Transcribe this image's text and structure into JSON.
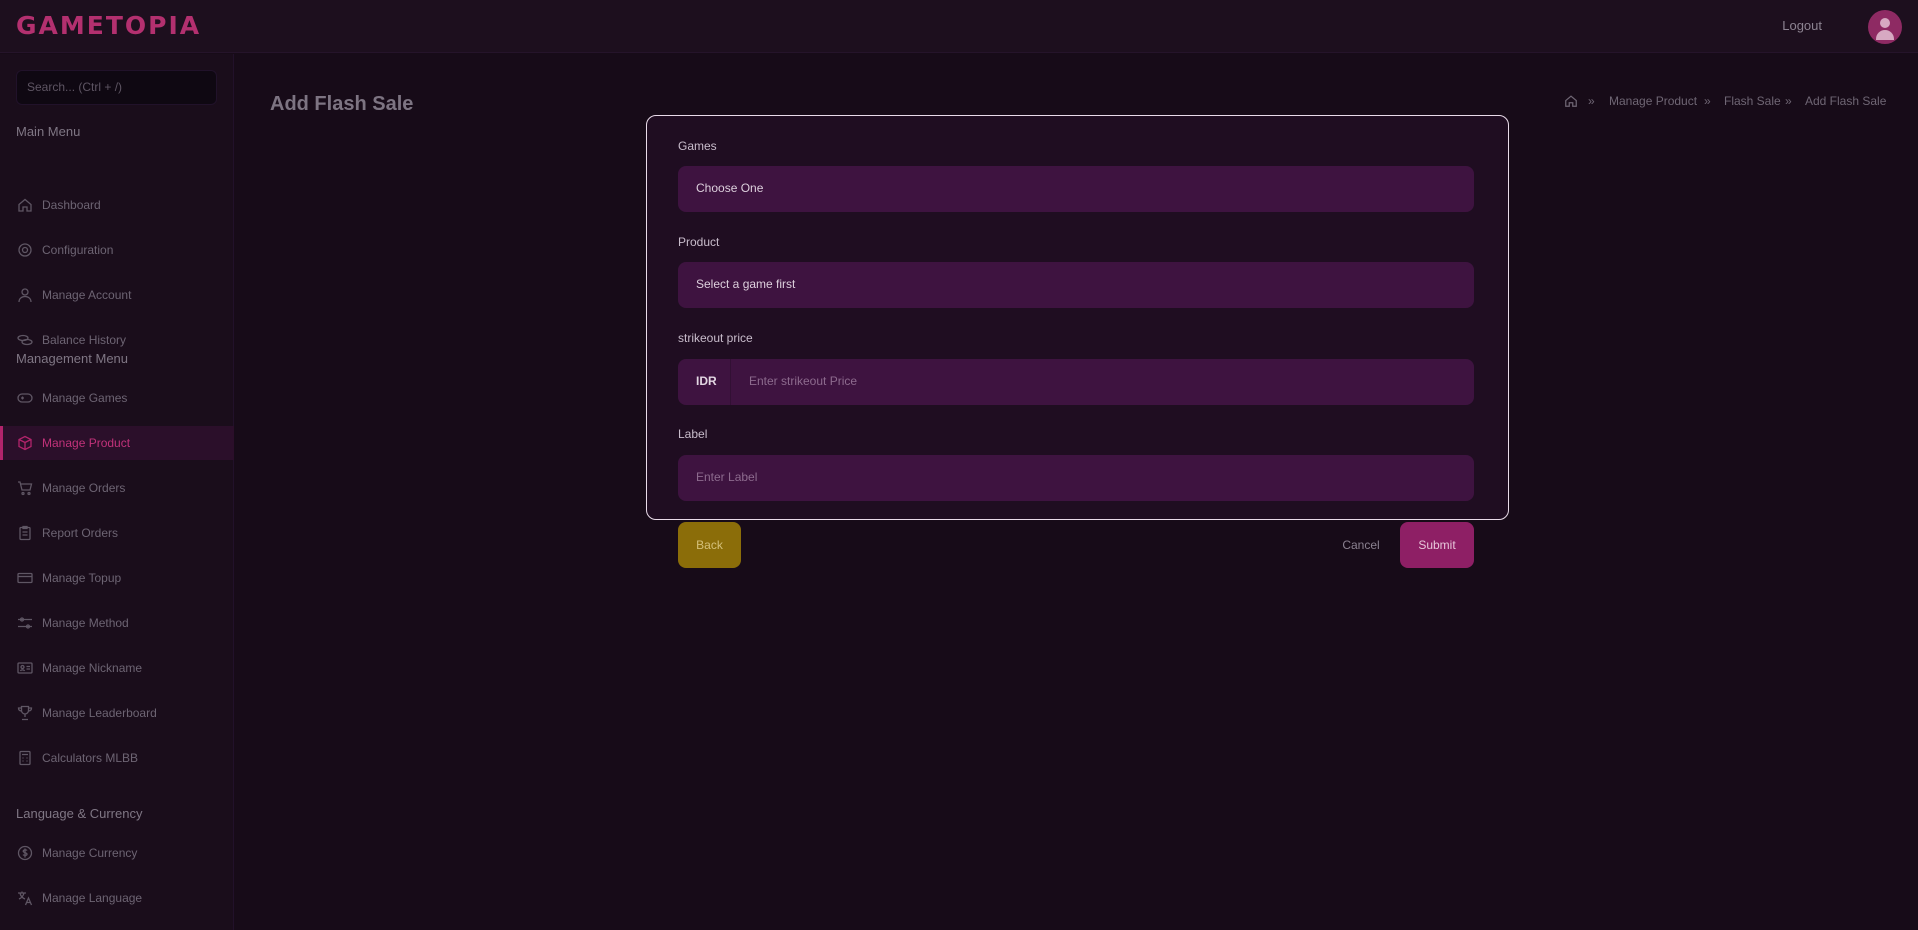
{
  "app": {
    "logo": "GAMETOPIA"
  },
  "header": {
    "logout_label": "Logout"
  },
  "sidebar": {
    "search_placeholder": "Search... (Ctrl + /)",
    "main_menu_title": "Main Menu",
    "main_items": [
      {
        "label": "Dashboard",
        "icon": "home-icon"
      },
      {
        "label": "Configuration",
        "icon": "gear-icon"
      },
      {
        "label": "Manage Account",
        "icon": "user-icon"
      },
      {
        "label": "Balance History",
        "icon": "coins-icon"
      }
    ],
    "management_title": "Management Menu",
    "management_items": [
      {
        "label": "Manage Games",
        "icon": "gamepad-icon"
      },
      {
        "label": "Manage Product",
        "icon": "box-icon",
        "active": true
      },
      {
        "label": "Manage Orders",
        "icon": "cart-icon"
      },
      {
        "label": "Report Orders",
        "icon": "clipboard-icon"
      },
      {
        "label": "Manage Topup",
        "icon": "card-icon"
      },
      {
        "label": "Manage Method",
        "icon": "sliders-icon"
      },
      {
        "label": "Manage Nickname",
        "icon": "id-card-icon"
      },
      {
        "label": "Manage Leaderboard",
        "icon": "trophy-icon"
      },
      {
        "label": "Calculators MLBB",
        "icon": "calculator-icon"
      }
    ],
    "lang_title": "Language & Currency",
    "lang_items": [
      {
        "label": "Manage Currency",
        "icon": "dollar-circle-icon"
      },
      {
        "label": "Manage Language",
        "icon": "translate-icon"
      }
    ]
  },
  "page": {
    "title": "Add Flash Sale",
    "breadcrumb": [
      "Manage Product",
      "Flash Sale",
      "Add Flash Sale"
    ]
  },
  "form": {
    "games_label": "Games",
    "games_value": "Choose One",
    "product_label": "Product",
    "product_value": "Select a game first",
    "strikeout_label": "strikeout price",
    "strikeout_addon": "IDR",
    "strikeout_placeholder": "Enter strikeout Price",
    "label_label": "Label",
    "label_placeholder": "Enter Label"
  },
  "actions": {
    "back": "Back",
    "cancel": "Cancel",
    "submit": "Submit"
  },
  "colors": {
    "accent": "#b1246b",
    "back_button": "#8b6d09",
    "submit_button": "#8e1f65"
  }
}
